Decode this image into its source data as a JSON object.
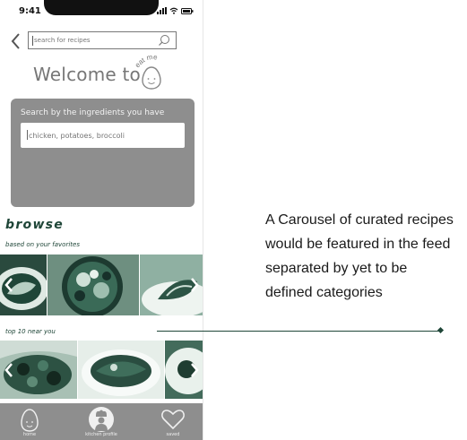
{
  "status_bar": {
    "time": "9:41"
  },
  "search": {
    "placeholder": "search for recipes"
  },
  "welcome": {
    "text": "Welcome to",
    "logo_text": "eat me"
  },
  "ingredients_card": {
    "title": "Search by the ingredients you have",
    "placeholder": "chicken, potatoes, broccoli"
  },
  "browse": {
    "heading": "browse",
    "sections": [
      {
        "label": "based on your favorites",
        "tiles": [
          "plated fish dish",
          "salad bowl",
          "grilled fish plate"
        ]
      },
      {
        "label": "top 10 near you",
        "tiles": [
          "fried wings platter",
          "rice plate",
          "dessert plate"
        ]
      }
    ]
  },
  "tab_bar": {
    "items": [
      {
        "label": "home",
        "icon": "egg-icon"
      },
      {
        "label": "kitchen profile",
        "icon": "chef-icon"
      },
      {
        "label": "saved",
        "icon": "heart-icon"
      }
    ]
  },
  "annotation": {
    "text": "A Carousel of curated recipes would be featured in the feed separated by yet to be defined categories"
  },
  "colors": {
    "accent": "#1f4638",
    "card_gray": "#8e8e8e",
    "photo_tint": "#2e6b55"
  }
}
